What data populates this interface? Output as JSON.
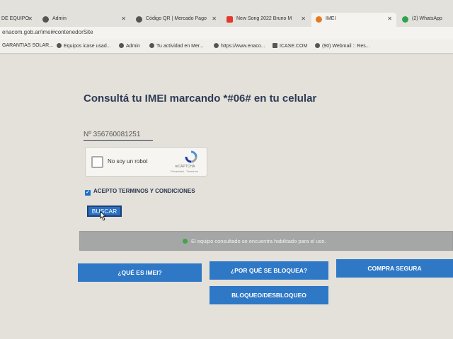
{
  "browser": {
    "tabs": [
      {
        "label": "DE EQUIPO"
      },
      {
        "label": "Admin"
      },
      {
        "label": "Código QR | Mercado Pago"
      },
      {
        "label": "New Song 2022 Bruno M"
      },
      {
        "label": "IMEI"
      },
      {
        "label": "(2) WhatsApp"
      }
    ],
    "url": "enacom.gob.ar/imei#contenedorSite",
    "bookmarks": [
      {
        "label": "GARANTIAS SOLAR..."
      },
      {
        "label": "Equipos icase usad..."
      },
      {
        "label": "Admin"
      },
      {
        "label": "Tu actividad en Mer..."
      },
      {
        "label": "https://www.enaco..."
      },
      {
        "label": "ICASE.COM"
      },
      {
        "label": "(90) Webmail :: Res..."
      }
    ]
  },
  "page": {
    "title": "Consultá tu IMEI marcando *#06# en tu celular",
    "imei_value": "Nº 356760081251",
    "captcha": {
      "label": "No soy un robot",
      "brand": "reCAPTCHA",
      "links": "Privacidad - Términos"
    },
    "terms_label": "ACEPTO TERMINOS Y CONDICIONES",
    "search_button": "BUSCAR",
    "status_message": "El equipo consultado se encuentra habilitado para el uso.",
    "buttons": {
      "what_is_imei": "¿QUÉ ES IMEI?",
      "why_blocked": "¿POR QUÉ SE BLOQUEA?",
      "safe_purchase": "COMPRA SEGURA",
      "block_unblock": "BLOQUEO/DESBLOQUEO"
    }
  },
  "colors": {
    "primary_button": "#2e78c6",
    "title_text": "#2d3b55",
    "status_bar": "#a4a7a6",
    "status_ok": "#3ea64a"
  }
}
